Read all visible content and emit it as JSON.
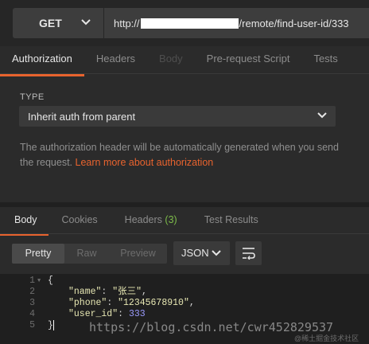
{
  "request": {
    "method": "GET",
    "url_prefix": "http://",
    "url_suffix": "/remote/find-user-id/333"
  },
  "tabs": [
    {
      "label": "Authorization",
      "state": "active"
    },
    {
      "label": "Headers",
      "state": "normal"
    },
    {
      "label": "Body",
      "state": "disabled"
    },
    {
      "label": "Pre-request Script",
      "state": "normal"
    },
    {
      "label": "Tests",
      "state": "normal"
    }
  ],
  "auth": {
    "type_label": "TYPE",
    "type_value": "Inherit auth from parent",
    "description": "The authorization header will be automatically generated when you send the request.",
    "link": "Learn more about authorization"
  },
  "response_tabs": {
    "body": "Body",
    "cookies": "Cookies",
    "headers_label": "Headers",
    "headers_count": "(3)",
    "test_results": "Test Results"
  },
  "view_modes": [
    "Pretty",
    "Raw",
    "Preview"
  ],
  "format": "JSON",
  "code_lines": [
    {
      "n": "1",
      "text": "{"
    },
    {
      "n": "2",
      "key": "\"name\"",
      "val": "\"张三\"",
      "val_type": "str",
      "end": ","
    },
    {
      "n": "3",
      "key": "\"phone\"",
      "val": "\"12345678910\"",
      "val_type": "str",
      "end": ","
    },
    {
      "n": "4",
      "key": "\"user_id\"",
      "val": "333",
      "val_type": "num",
      "end": ""
    },
    {
      "n": "5",
      "text": "}"
    }
  ],
  "watermark": "https://blog.csdn.net/cwr452829537",
  "watermark2": "@稀土掘金技术社区",
  "colors": {
    "accent": "#e8632e",
    "count": "#7dbb4a",
    "number": "#9c9cff"
  }
}
